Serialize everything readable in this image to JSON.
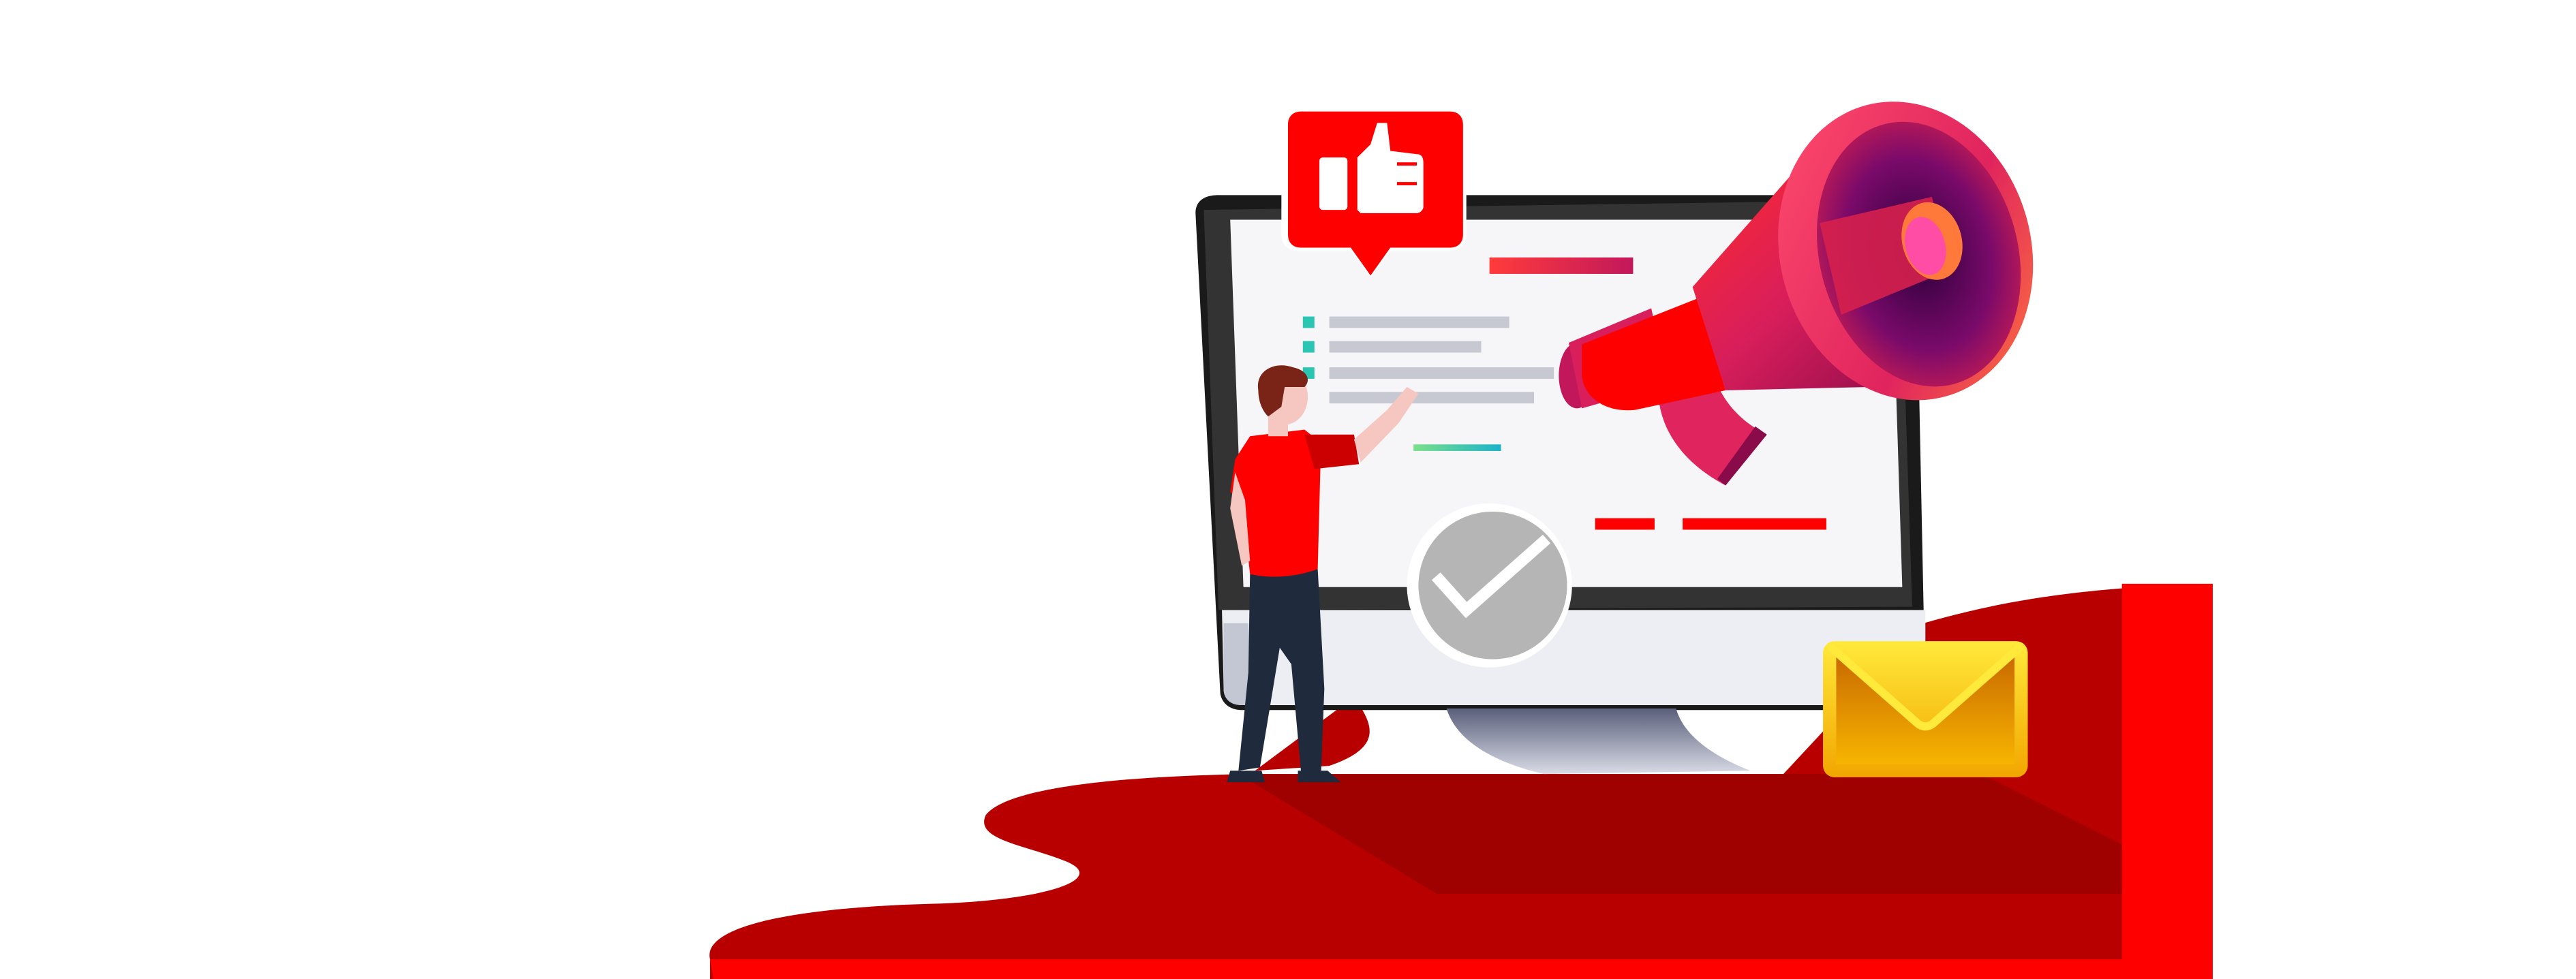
{
  "illustration": {
    "icons": {
      "thumbs_up": "thumbs-up-icon",
      "megaphone": "megaphone-icon",
      "check": "check-icon",
      "envelope": "envelope-icon"
    },
    "colors": {
      "brand_red": "#ff0000",
      "dark_red": "#b80000",
      "shadow_red": "#8a0000",
      "monitor_frame": "#333333",
      "screen": "#f6f6f8",
      "placeholder_line": "#c6c8d2",
      "teal_bullet": "#2bc5b4",
      "envelope_gold": "#f5c400",
      "check_grey": "#b5b5b5"
    }
  }
}
